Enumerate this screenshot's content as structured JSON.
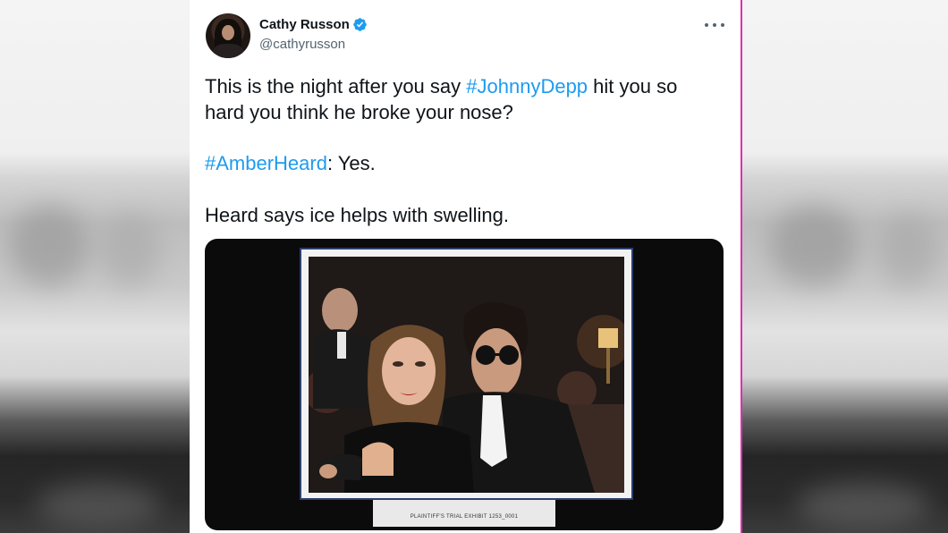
{
  "tweet": {
    "author": {
      "display_name": "Cathy Russon",
      "handle": "@cathyrusson",
      "verified": true,
      "avatar_icon": "avatar-photo"
    },
    "more_icon": "more-horizontal-icon",
    "text_lines": {
      "line1_prefix": "This is the night after you say ",
      "line1_hashtag": "#JohnnyDepp",
      "line1_suffix": " hit you so",
      "line2": "hard you think he broke your nose?",
      "line3_hashtag": "#AmberHeard",
      "line3_suffix": ": Yes.",
      "line4": "Heard says ice helps with swelling."
    },
    "media": {
      "type": "photo",
      "exhibit_label": "PLAINTIFF'S TRIAL EXHIBIT 1253_0001"
    }
  },
  "colors": {
    "hashtag": "#1d9bf0",
    "verified_badge": "#1d9bf0",
    "text": "#0f1419",
    "secondary_text": "#536471",
    "exhibit_border": "#2d3f6f"
  }
}
